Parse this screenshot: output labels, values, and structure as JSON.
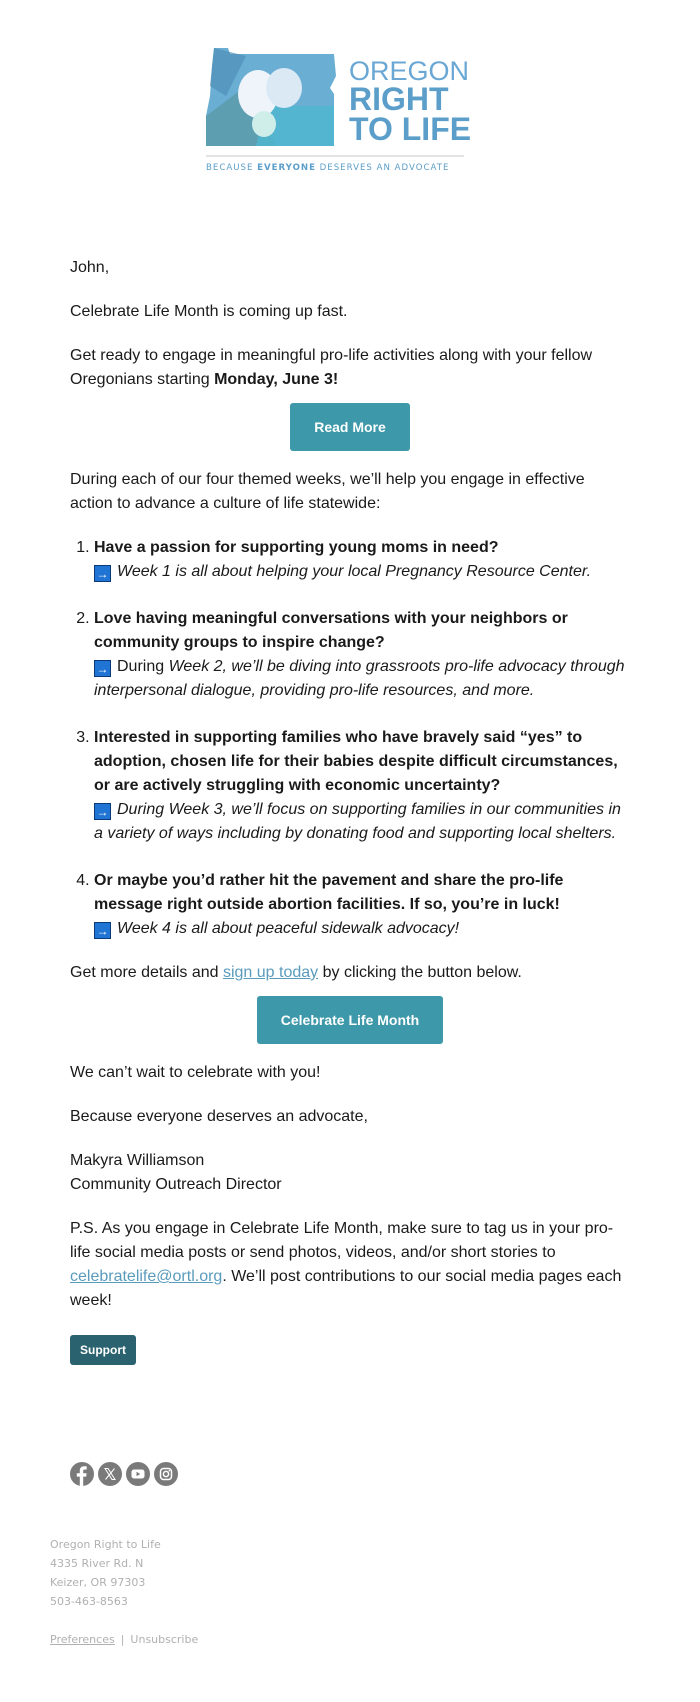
{
  "brand": {
    "line1": "OREGON",
    "line2": "RIGHT",
    "line3": "TO LIFE",
    "tagline_pre": "BECAUSE ",
    "tagline_bold": "EVERYONE",
    "tagline_post": " DESERVES AN ADVOCATE",
    "colors": {
      "primary": "#5b9ec9",
      "button": "#3d98aa",
      "support_button": "#2a6270",
      "link": "#5a9bbd",
      "arrow_box": "#1f74d4"
    }
  },
  "body": {
    "greeting": "John,",
    "intro": "Celebrate Life Month is coming up fast.",
    "ready_pre": "Get ready to engage in meaningful pro-life activities along with your fellow Oregonians starting ",
    "ready_bold": "Monday, June 3!",
    "read_more_label": "Read More",
    "weeks_intro": "During each of our four themed weeks, we’ll help you engage in effective action to advance a culture of life statewide:",
    "weeks": [
      {
        "question": "Have a passion for supporting young moms in need?",
        "detail_plain": "",
        "detail_italic": "Week 1 is all about helping your local Pregnancy Resource Center."
      },
      {
        "question": "Love having meaningful conversations with your neighbors or community groups to inspire change?",
        "detail_plain": "During ",
        "detail_italic": "Week 2, we’ll be diving into grassroots pro-life advocacy through interpersonal dialogue, providing pro-life resources, and more."
      },
      {
        "question": "Interested in supporting families who have bravely said “yes” to adoption, chosen life for their babies despite difficult circumstances, or are actively struggling with economic uncertainty?",
        "detail_plain": "",
        "detail_italic": "During Week 3, we’ll focus on supporting families in our communities in a variety of ways including by donating food and supporting local shelters."
      },
      {
        "question": "Or maybe you’d rather hit the pavement and share the pro-life message right outside abortion facilities. If so, you’re in luck!",
        "detail_plain": "",
        "detail_italic": "Week 4 is all about peaceful sidewalk advocacy!"
      }
    ],
    "arrow_icon": "→",
    "details_pre": "Get more details and ",
    "details_link": "sign up today",
    "details_post": " by clicking the button below.",
    "celebrate_label": "Celebrate Life Month",
    "closing": "We can’t wait to celebrate with you!",
    "signoff": "Because everyone deserves an advocate,",
    "signer_name": "Makyra Williamson",
    "signer_title": "Community Outreach Director",
    "ps_pre": "P.S. As you engage in Celebrate Life Month, make sure to tag us in your pro-life social media posts or send photos, videos, and/or short stories to ",
    "ps_link": "celebratelife@ortl.org",
    "ps_post": ". We’ll post contributions to our social media pages each week!",
    "support_label": "Support"
  },
  "social": [
    {
      "name": "facebook-icon",
      "glyph": "f"
    },
    {
      "name": "x-icon",
      "glyph": "𝕏"
    },
    {
      "name": "youtube-icon",
      "glyph": "▶"
    },
    {
      "name": "instagram-icon",
      "glyph": "◎"
    }
  ],
  "footer": {
    "org": "Oregon Right to Life",
    "address1": "4335 River Rd. N",
    "address2": "Keizer, OR 97303",
    "phone": "503-463-8563",
    "preferences": "Preferences",
    "separator": "|",
    "unsubscribe": "Unsubscribe"
  }
}
